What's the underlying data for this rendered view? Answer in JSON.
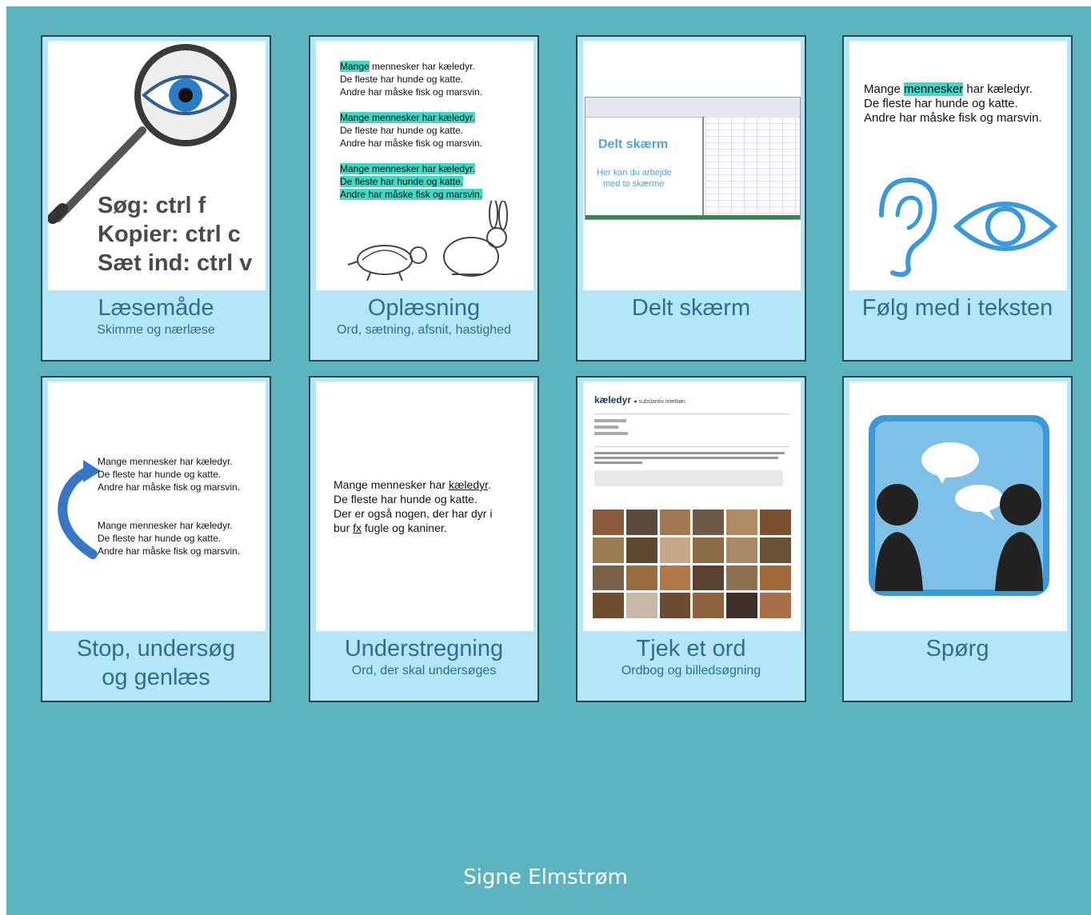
{
  "cards": [
    {
      "title": "Læsemåde",
      "subtitle": "Skimme og nærlæse",
      "art": {
        "lines": [
          "Søg: ctrl f",
          "Kopier: ctrl c",
          "Sæt ind: ctrl v"
        ]
      }
    },
    {
      "title": "Oplæsning",
      "subtitle": "Ord, sætning, afsnit, hastighed",
      "art": {
        "lines": [
          "Mange",
          "mennesker har kæledyr.",
          "De fleste har hunde og katte.",
          "Andre har måske fisk og marsvin."
        ]
      }
    },
    {
      "title": "Delt skærm",
      "subtitle": "",
      "art": {
        "heading": "Delt skærm",
        "text1": "Her kan du arbejde",
        "text2": "med to skærme"
      }
    },
    {
      "title": "Følg med i teksten",
      "subtitle": "",
      "art": {
        "pre": "Mange ",
        "hl": "mennesker",
        "post": " har kæledyr.",
        "line2": "De fleste har hunde og katte.",
        "line3": "Andre har måske fisk og marsvin."
      }
    },
    {
      "title": "Stop, undersøg",
      "title2": "og genlæs",
      "subtitle": "",
      "art": {
        "l1": "Mange mennesker har kæledyr.",
        "l2": "De fleste har hunde og katte.",
        "l3": "Andre har måske fisk og marsvin."
      }
    },
    {
      "title": "Understregning",
      "subtitle": "Ord, der skal undersøges",
      "art": {
        "l1a": "Mange mennesker har ",
        "l1b": "kæledyr",
        "l1c": ".",
        "l2": "De fleste har hunde og katte.",
        "l3": "Der er også nogen, der har dyr i",
        "l4a": "bur ",
        "l4b": "fx",
        "l4c": " fugle og kaniner."
      }
    },
    {
      "title": "Tjek et ord",
      "subtitle": "Ordbog og billedsøgning",
      "art": {
        "word": "kæledyr",
        "wordclass": "substantiv intetkøn"
      }
    },
    {
      "title": "Spørg",
      "subtitle": "",
      "art": {}
    }
  ],
  "author": "Signe Elmstrøm",
  "colors": {
    "background": "#5cb4c0",
    "card_band": "#b3e6f9",
    "title": "#2e6e90",
    "highlight": "#44d7c6"
  }
}
